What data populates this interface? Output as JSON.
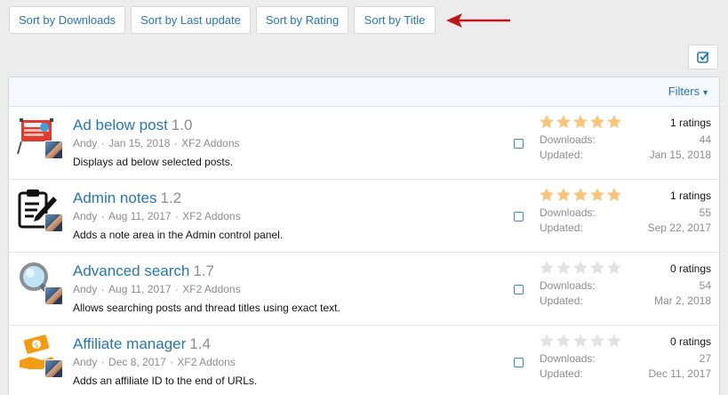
{
  "sort_buttons": [
    {
      "label": "Sort by Downloads"
    },
    {
      "label": "Sort by Last update"
    },
    {
      "label": "Sort by Rating"
    },
    {
      "label": "Sort by Title"
    }
  ],
  "filters_label": "Filters",
  "colors": {
    "link": "#2577b1",
    "star_filled": "#f9c479",
    "star_empty": "#e2e2e2",
    "arrow": "#c0141b"
  },
  "addons": [
    {
      "icon": "ad-banner-icon",
      "title": "Ad below post",
      "version": "1.0",
      "author": "Andy",
      "date": "Jan 15, 2018",
      "category": "XF2 Addons",
      "description": "Displays ad below selected posts.",
      "rating": 5,
      "ratings_text": "1 ratings",
      "downloads_label": "Downloads:",
      "downloads": "44",
      "updated_label": "Updated:",
      "updated": "Jan 15, 2018"
    },
    {
      "icon": "clipboard-pencil-icon",
      "title": "Admin notes",
      "version": "1.2",
      "author": "Andy",
      "date": "Aug 11, 2017",
      "category": "XF2 Addons",
      "description": "Adds a note area in the Admin control panel.",
      "rating": 5,
      "ratings_text": "1 ratings",
      "downloads_label": "Downloads:",
      "downloads": "55",
      "updated_label": "Updated:",
      "updated": "Sep 22, 2017"
    },
    {
      "icon": "magnifier-icon",
      "title": "Advanced search",
      "version": "1.7",
      "author": "Andy",
      "date": "Aug 11, 2017",
      "category": "XF2 Addons",
      "description": "Allows searching posts and thread titles using exact text.",
      "rating": 0,
      "ratings_text": "0 ratings",
      "downloads_label": "Downloads:",
      "downloads": "54",
      "updated_label": "Updated:",
      "updated": "Mar 2, 2018"
    },
    {
      "icon": "money-hand-icon",
      "title": "Affiliate manager",
      "version": "1.4",
      "author": "Andy",
      "date": "Dec 8, 2017",
      "category": "XF2 Addons",
      "description": "Adds an affiliate ID to the end of URLs.",
      "rating": 0,
      "ratings_text": "0 ratings",
      "downloads_label": "Downloads:",
      "downloads": "27",
      "updated_label": "Updated:",
      "updated": "Dec 11, 2017"
    }
  ]
}
